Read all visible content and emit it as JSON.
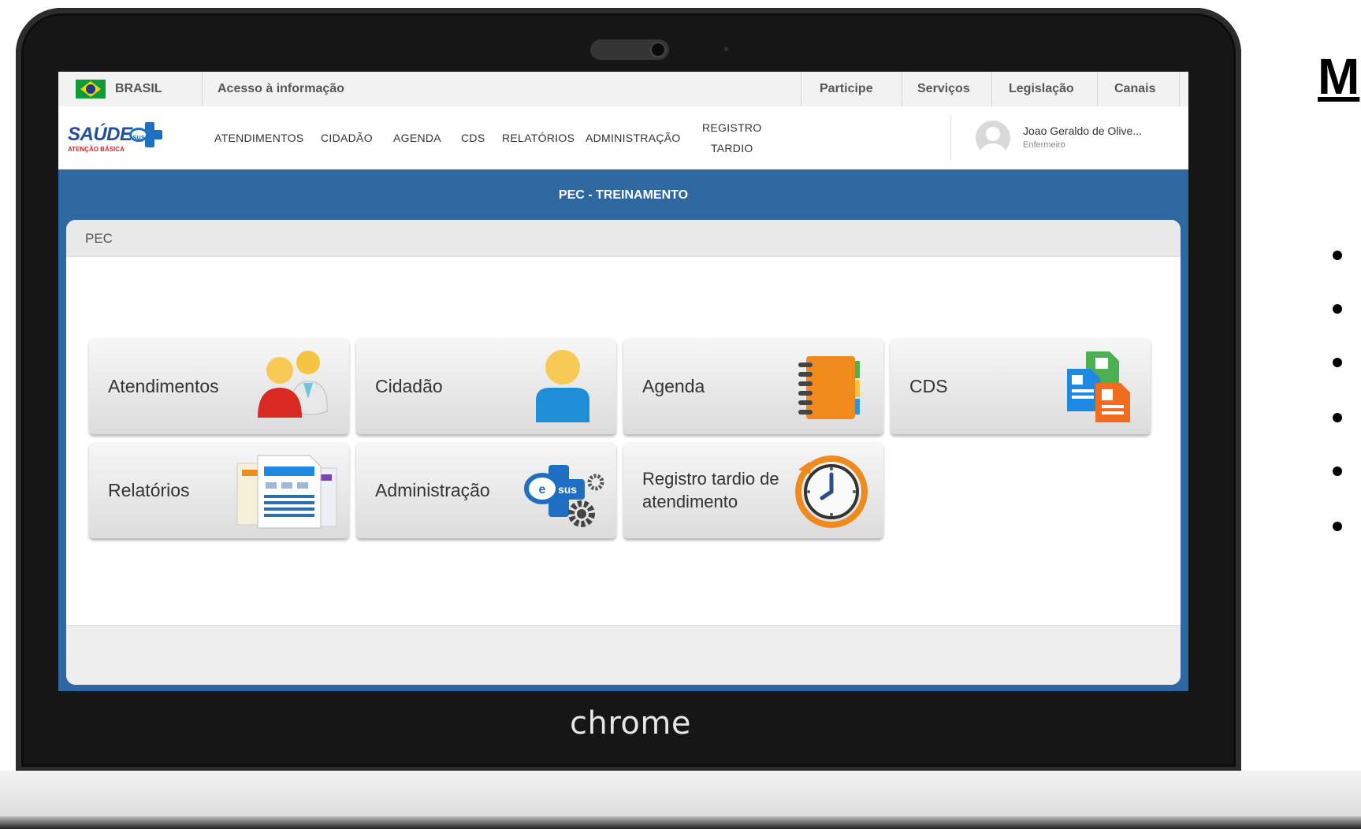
{
  "browser": {
    "brand": "chrome"
  },
  "gov_bar": {
    "country": "BRASIL",
    "access_info": "Acesso à informação",
    "links": [
      "Participe",
      "Serviços",
      "Legislação",
      "Canais"
    ]
  },
  "app": {
    "logo": {
      "word": "SAÚDE",
      "esus": "sus",
      "subtitle": "ATENÇÃO BÁSICA"
    },
    "nav": [
      "ATENDIMENTOS",
      "CIDADÃO",
      "AGENDA",
      "CDS",
      "RELATÓRIOS",
      "ADMINISTRAÇÃO"
    ],
    "nav_registro": {
      "line1": "REGISTRO",
      "line2": "TARDIO"
    },
    "user": {
      "name": "Joao Geraldo de Olive...",
      "role": "Enfermeiro"
    }
  },
  "banner": {
    "title": "PEC - TREINAMENTO"
  },
  "panel": {
    "title": "PEC"
  },
  "tiles": [
    {
      "label": "Atendimentos",
      "icon": "attendance-people-icon"
    },
    {
      "label": "Cidadão",
      "icon": "citizen-person-icon"
    },
    {
      "label": "Agenda",
      "icon": "agenda-notebook-icon"
    },
    {
      "label": "CDS",
      "icon": "cds-forms-icon"
    },
    {
      "label": "Relatórios",
      "icon": "reports-documents-icon"
    },
    {
      "label": "Administração",
      "icon": "admin-esus-gears-icon"
    },
    {
      "label": "Registro tardio de atendimento",
      "icon": "late-record-clock-icon"
    }
  ],
  "colors": {
    "banner_blue": "#2f67a0",
    "tile_gradient_top": "#f7f7f7",
    "tile_gradient_bottom": "#dcdcdc"
  },
  "slide": {
    "heading": "M"
  }
}
